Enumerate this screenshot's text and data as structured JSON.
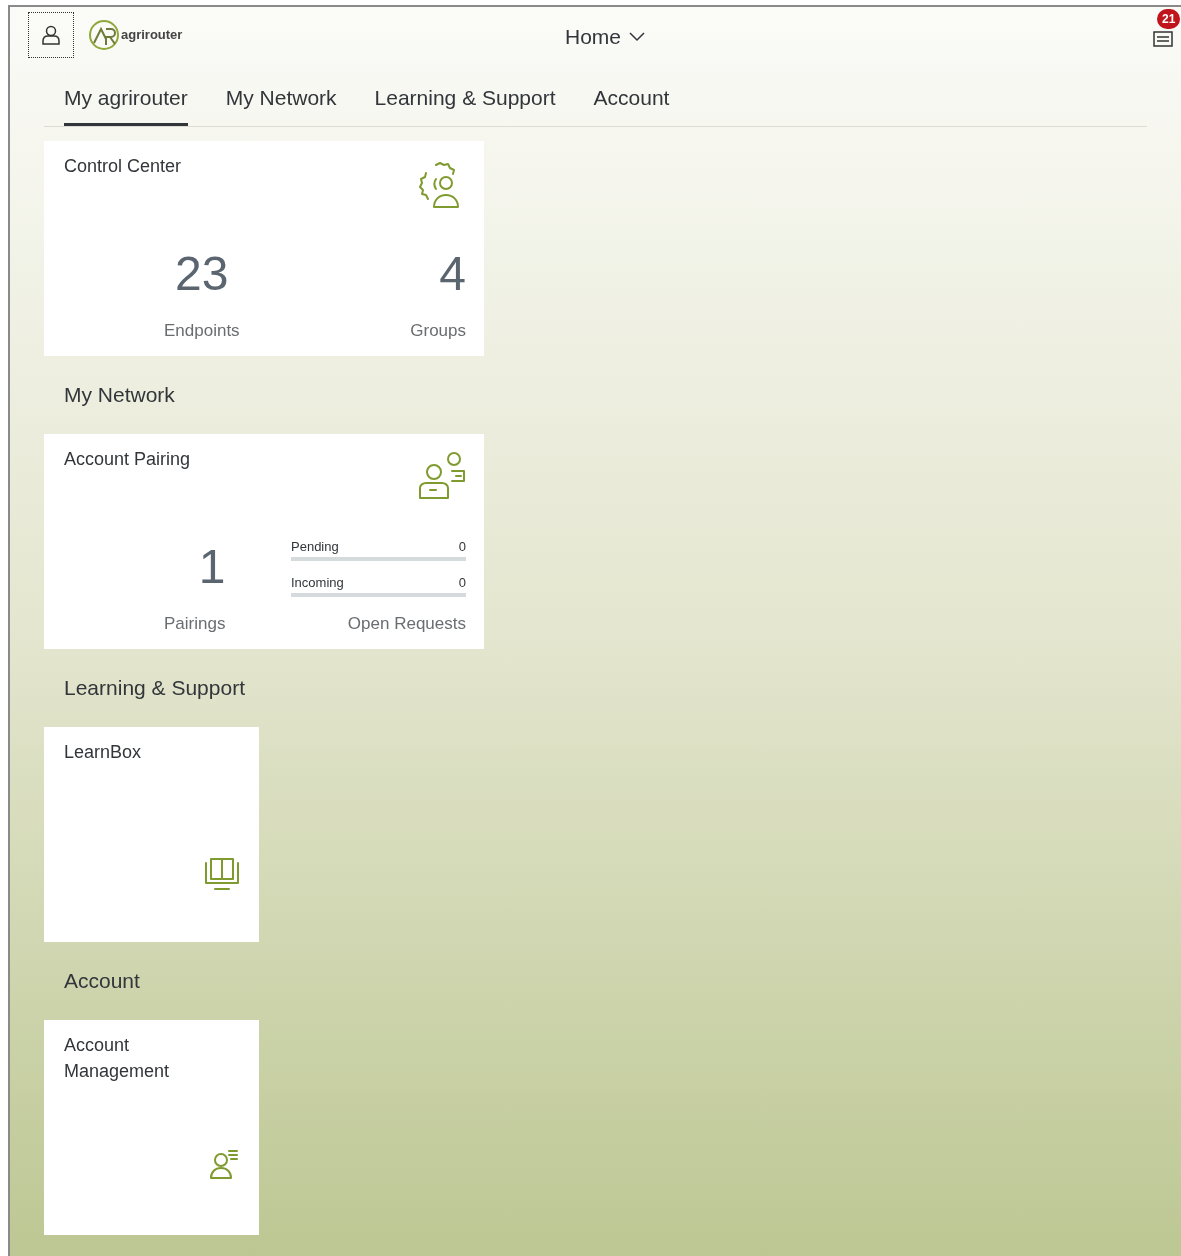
{
  "header": {
    "logo_text": "agrirouter",
    "title": "Home",
    "notification_count": "21"
  },
  "tabs": [
    {
      "label": "My agrirouter",
      "selected": true
    },
    {
      "label": "My Network",
      "selected": false
    },
    {
      "label": "Learning & Support",
      "selected": false
    },
    {
      "label": "Account",
      "selected": false
    }
  ],
  "sections": [
    {
      "tiles": [
        {
          "kind": "control",
          "title": "Control Center",
          "stats": [
            {
              "value": "23",
              "label": "Endpoints"
            },
            {
              "value": "4",
              "label": "Groups"
            }
          ]
        }
      ]
    },
    {
      "heading": "My Network",
      "tiles": [
        {
          "kind": "pairing",
          "title": "Account Pairing",
          "value": "1",
          "label": "Pairings",
          "requests": [
            {
              "label": "Pending",
              "count": "0",
              "level": 0
            },
            {
              "label": "Incoming",
              "count": "0",
              "level": 0
            }
          ],
          "requests_label": "Open Requests"
        }
      ]
    },
    {
      "heading": "Learning & Support",
      "tiles": [
        {
          "kind": "learn",
          "title": "LearnBox"
        }
      ]
    },
    {
      "heading": "Account",
      "tiles": [
        {
          "kind": "account",
          "title": "Account Management"
        }
      ]
    }
  ]
}
